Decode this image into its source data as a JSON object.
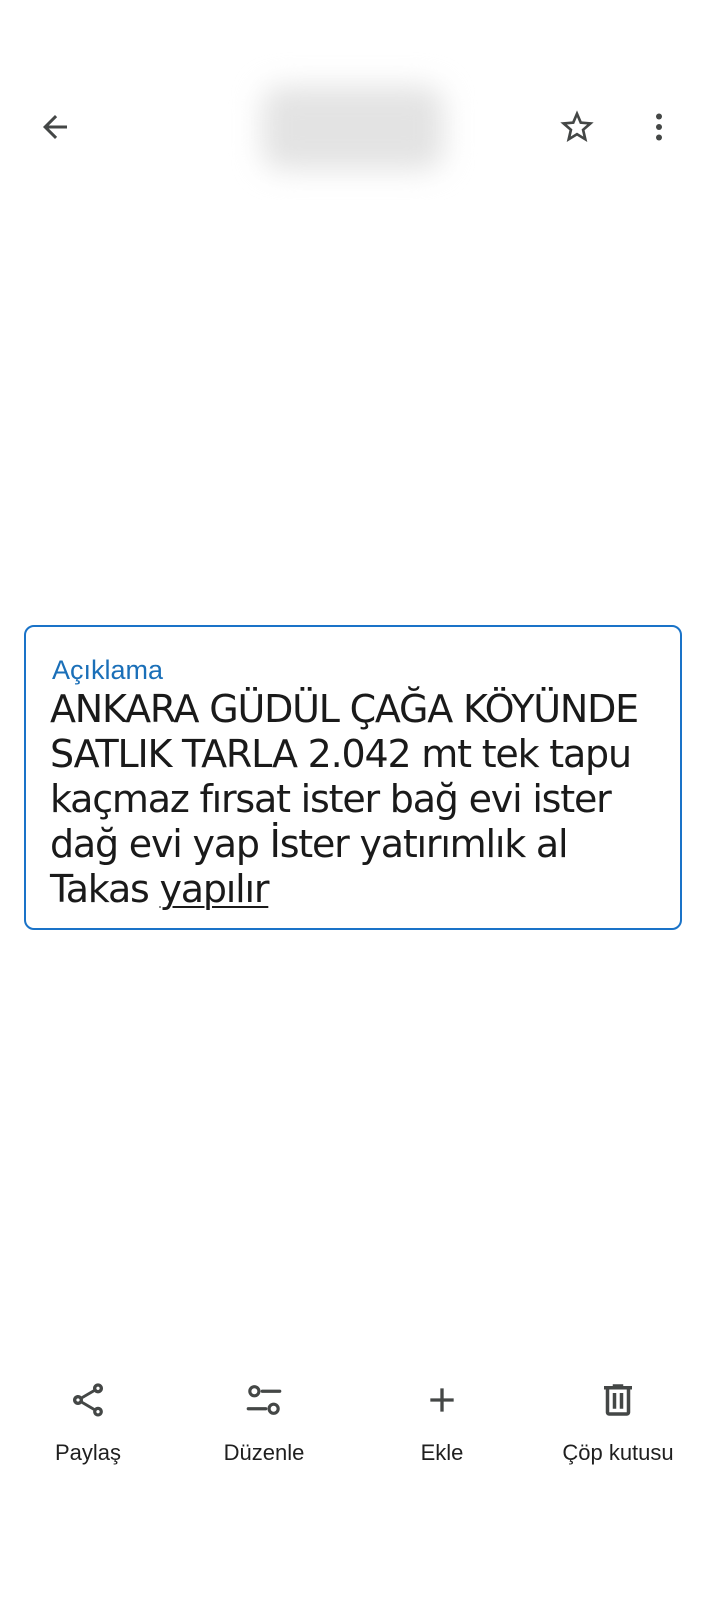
{
  "topbar": {
    "back_icon": "arrow-left-icon",
    "star_icon": "star-outline-icon",
    "more_icon": "more-vertical-icon"
  },
  "description": {
    "label": "Açıklama",
    "lines": [
      "ANKARA GÜDÜL ÇAĞA KÖYÜNDE",
      "SATLIK TARLA 2.042 mt tek tapu",
      "kaçmaz fırsat ister bağ evi ister",
      "dağ evi  yap İster yatırımlık al"
    ],
    "last_line_prefix": "Takas ",
    "last_line_link": "yapılır"
  },
  "actions": [
    {
      "label": "Paylaş",
      "icon": "share-icon"
    },
    {
      "label": "Düzenle",
      "icon": "edit-sliders-icon"
    },
    {
      "label": "Ekle",
      "icon": "plus-icon"
    },
    {
      "label": "Çöp kutusu",
      "icon": "trash-icon"
    }
  ],
  "colors": {
    "accent": "#1a73c8",
    "icon": "#444746",
    "background": "#ffffff"
  }
}
